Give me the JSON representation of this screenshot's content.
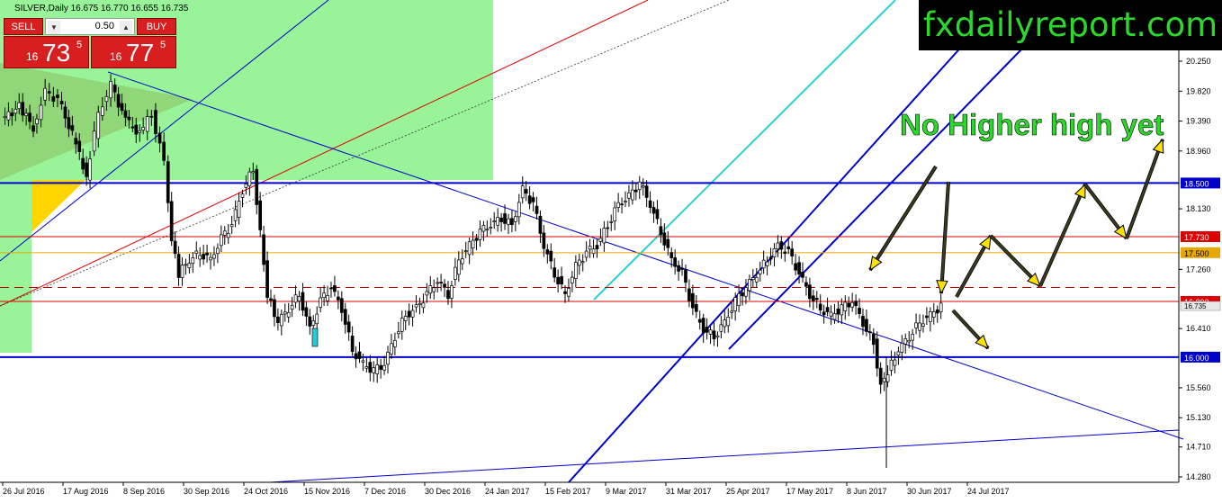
{
  "header": {
    "symbol_line": "SILVER,Daily  16.675 16.770 16.655 16.735"
  },
  "trade_panel": {
    "sell_label": "SELL",
    "buy_label": "BUY",
    "lot_value": "0.50",
    "sell_price": {
      "prefix": "16",
      "main": "73",
      "sup": "5"
    },
    "buy_price": {
      "prefix": "16",
      "main": "77",
      "sup": "5"
    }
  },
  "brand": {
    "text": "fxdailyreport.com"
  },
  "annotation": {
    "text": "No Higher high yet"
  },
  "chart_data": {
    "type": "candlestick",
    "symbol": "SILVER",
    "timeframe": "Daily",
    "last": {
      "open": 16.675,
      "high": 16.77,
      "low": 16.655,
      "close": 16.735
    },
    "y_ticks": [
      "20.250",
      "19.820",
      "19.390",
      "18.960",
      "18.130",
      "17.260",
      "16.410",
      "15.560",
      "15.130",
      "14.710",
      "14.280"
    ],
    "ylim": [
      14.2,
      20.6
    ],
    "x_ticks": [
      "26 Jul 2016",
      "17 Aug 2016",
      "8 Sep 2016",
      "30 Sep 2016",
      "24 Oct 2016",
      "15 Nov 2016",
      "7 Dec 2016",
      "30 Dec 2016",
      "24 Jan 2017",
      "15 Feb 2017",
      "9 Mar 2017",
      "31 Mar 2017",
      "25 Apr 2017",
      "17 May 2017",
      "8 Jun 2017",
      "30 Jun 2017",
      "24 Jul 2017"
    ],
    "levels": [
      {
        "label": "18.500",
        "value": 18.5,
        "color": "#0000cc",
        "style": "solid"
      },
      {
        "label": "17.730",
        "value": 17.73,
        "color": "#dd0000",
        "style": "solid"
      },
      {
        "label": "17.500",
        "value": 17.5,
        "color": "#e6a800",
        "style": "solid"
      },
      {
        "label": "",
        "value": 17.0,
        "color": "#c00000",
        "style": "dashed"
      },
      {
        "label": "16.800",
        "value": 16.8,
        "color": "#dd0000",
        "style": "solid"
      },
      {
        "label": "16.000",
        "value": 16.0,
        "color": "#0000cc",
        "style": "solid"
      }
    ],
    "current_price_label": "16.735",
    "path_points": [
      [
        0,
        19.4
      ],
      [
        10,
        19.6
      ],
      [
        18,
        19.3
      ],
      [
        25,
        19.8
      ],
      [
        32,
        19.7
      ],
      [
        40,
        19.2
      ],
      [
        48,
        18.6
      ],
      [
        55,
        19.5
      ],
      [
        62,
        19.9
      ],
      [
        70,
        19.4
      ],
      [
        78,
        19.2
      ],
      [
        85,
        19.5
      ],
      [
        92,
        18.8
      ],
      [
        96,
        17.7
      ],
      [
        100,
        17.2
      ],
      [
        106,
        17.4
      ],
      [
        112,
        17.5
      ],
      [
        118,
        17.4
      ],
      [
        124,
        17.7
      ],
      [
        130,
        17.9
      ],
      [
        136,
        18.4
      ],
      [
        142,
        18.7
      ],
      [
        146,
        17.8
      ],
      [
        150,
        16.9
      ],
      [
        156,
        16.5
      ],
      [
        162,
        16.7
      ],
      [
        168,
        16.9
      ],
      [
        174,
        16.4
      ],
      [
        180,
        16.8
      ],
      [
        186,
        17.0
      ],
      [
        192,
        16.7
      ],
      [
        198,
        16.1
      ],
      [
        204,
        15.9
      ],
      [
        210,
        15.8
      ],
      [
        216,
        15.9
      ],
      [
        222,
        16.3
      ],
      [
        228,
        16.6
      ],
      [
        234,
        16.7
      ],
      [
        240,
        16.9
      ],
      [
        246,
        17.1
      ],
      [
        252,
        16.9
      ],
      [
        258,
        17.4
      ],
      [
        264,
        17.6
      ],
      [
        270,
        17.8
      ],
      [
        276,
        17.9
      ],
      [
        282,
        18.0
      ],
      [
        288,
        17.9
      ],
      [
        294,
        18.4
      ],
      [
        300,
        18.2
      ],
      [
        306,
        17.6
      ],
      [
        312,
        17.2
      ],
      [
        318,
        16.9
      ],
      [
        324,
        17.3
      ],
      [
        330,
        17.5
      ],
      [
        336,
        17.6
      ],
      [
        342,
        17.9
      ],
      [
        348,
        18.2
      ],
      [
        354,
        18.3
      ],
      [
        360,
        18.5
      ],
      [
        366,
        18.2
      ],
      [
        372,
        17.8
      ],
      [
        378,
        17.4
      ],
      [
        384,
        17.2
      ],
      [
        390,
        16.7
      ],
      [
        396,
        16.4
      ],
      [
        402,
        16.3
      ],
      [
        408,
        16.5
      ],
      [
        414,
        16.8
      ],
      [
        420,
        17.0
      ],
      [
        426,
        17.2
      ],
      [
        432,
        17.4
      ],
      [
        438,
        17.6
      ],
      [
        444,
        17.5
      ],
      [
        450,
        17.2
      ],
      [
        456,
        16.9
      ],
      [
        462,
        16.7
      ],
      [
        468,
        16.6
      ],
      [
        474,
        16.7
      ],
      [
        480,
        16.8
      ],
      [
        486,
        16.5
      ],
      [
        492,
        16.2
      ],
      [
        496,
        15.6
      ],
      [
        500,
        15.8
      ],
      [
        506,
        16.1
      ],
      [
        512,
        16.3
      ],
      [
        518,
        16.5
      ],
      [
        524,
        16.6
      ],
      [
        530,
        16.735
      ]
    ],
    "projection_arrows": [
      {
        "from": [
          1040,
          185
        ],
        "to": [
          967,
          300
        ]
      },
      {
        "from": [
          1054,
          202
        ],
        "to": [
          1046,
          326
        ]
      },
      {
        "from": [
          1059,
          345
        ],
        "to": [
          1098,
          387
        ]
      },
      {
        "from": [
          1063,
          330
        ],
        "to": [
          1101,
          262
        ]
      },
      {
        "from": [
          1101,
          262
        ],
        "to": [
          1156,
          318
        ]
      },
      {
        "from": [
          1156,
          318
        ],
        "to": [
          1206,
          205
        ]
      },
      {
        "from": [
          1206,
          205
        ],
        "to": [
          1252,
          265
        ]
      },
      {
        "from": [
          1252,
          265
        ],
        "to": [
          1292,
          155
        ]
      }
    ]
  }
}
